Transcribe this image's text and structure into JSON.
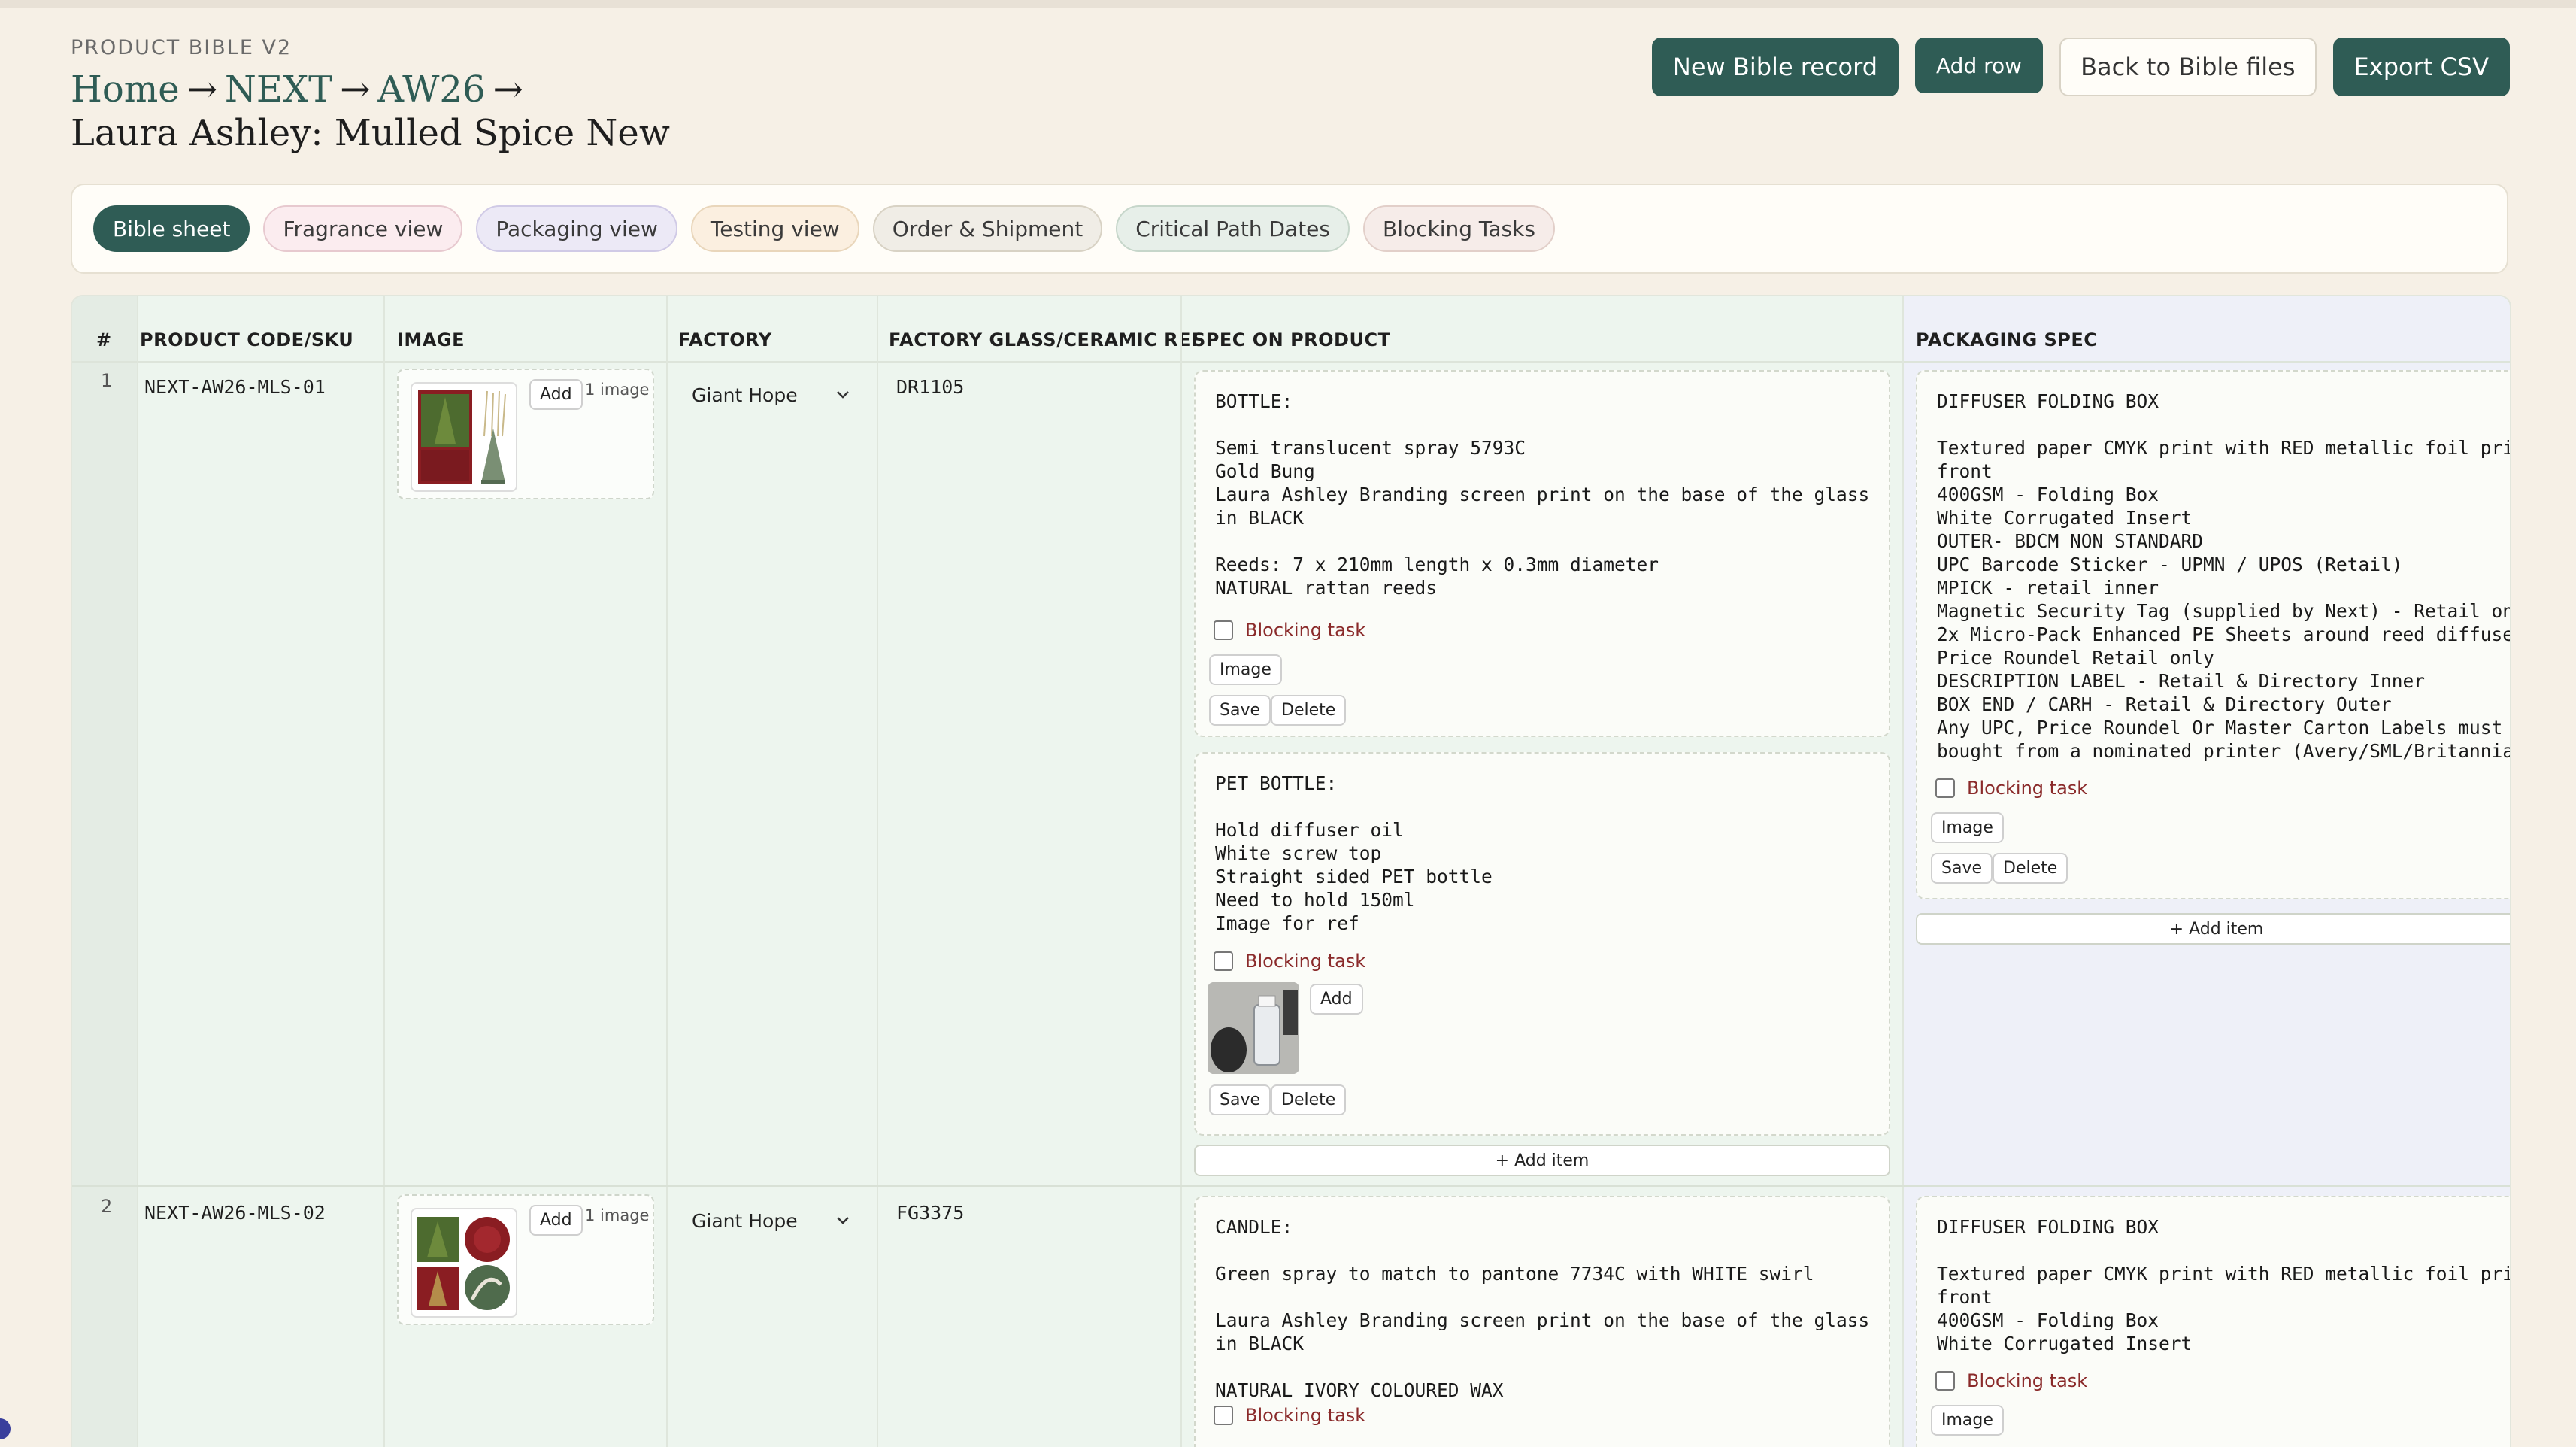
{
  "header": {
    "app_label": "PRODUCT BIBLE V2",
    "breadcrumb": [
      "Home",
      "NEXT",
      "AW26"
    ],
    "arrow": "→",
    "page_title": "Laura Ashley: Mulled Spice New"
  },
  "actions": {
    "new_record": "New Bible record",
    "add_row": "Add row",
    "back": "Back to Bible files",
    "export": "Export CSV"
  },
  "tabs": [
    "Bible sheet",
    "Fragrance view",
    "Packaging view",
    "Testing view",
    "Order & Shipment",
    "Critical Path Dates",
    "Blocking Tasks"
  ],
  "table": {
    "columns": [
      "#",
      "PRODUCT CODE/SKU",
      "IMAGE",
      "FACTORY",
      "FACTORY GLASS/CERAMIC REF",
      "SPEC ON PRODUCT",
      "PACKAGING SPEC"
    ],
    "labels": {
      "add": "Add",
      "image": "Image",
      "save": "Save",
      "delete": "Delete",
      "blocking_task": "Blocking task",
      "add_item": "+ Add item"
    },
    "rows": [
      {
        "num": "1",
        "sku": "NEXT-AW26-MLS-01",
        "image_count": "1 image",
        "factory": "Giant Hope",
        "ref": "DR1105",
        "spec_items": [
          "BOTTLE:\n\nSemi translucent spray 5793C\nGold Bung\nLaura Ashley Branding screen print on the base of the glass\nin BLACK\n\nReeds: 7 x 210mm length x 0.3mm diameter\nNATURAL rattan reeds",
          "PET BOTTLE:\n\nHold diffuser oil\nWhite screw top\nStraight sided PET bottle\nNeed to hold 150ml\nImage for ref"
        ],
        "packaging": "DIFFUSER FOLDING BOX\n\nTextured paper CMYK print with RED metallic foil print on\nfront\n400GSM - Folding Box\nWhite Corrugated Insert\nOUTER- BDCM NON STANDARD\nUPC Barcode Sticker - UPMN / UPOS (Retail)\nMPICK - retail inner\nMagnetic Security Tag (supplied by Next) - Retail only\n2x Micro-Pack Enhanced PE Sheets around reed diffuser\nPrice Roundel Retail only\nDESCRIPTION LABEL - Retail & Directory Inner\nBOX END / CARH - Retail & Directory Outer\nAny UPC, Price Roundel Or Master Carton Labels must be\nbought from a nominated printer (Avery/SML/Britannia)"
      },
      {
        "num": "2",
        "sku": "NEXT-AW26-MLS-02",
        "image_count": "1 image",
        "factory": "Giant Hope",
        "ref": "FG3375",
        "spec_items": [
          "CANDLE:\n\nGreen spray to match to pantone 7734C with WHITE swirl\n\nLaura Ashley Branding screen print on the base of the glass\nin BLACK\n\nNATURAL IVORY COLOURED WAX"
        ],
        "packaging": "DIFFUSER FOLDING BOX\n\nTextured paper CMYK print with RED metallic foil print on\nfront\n400GSM - Folding Box\nWhite Corrugated Insert"
      }
    ]
  }
}
